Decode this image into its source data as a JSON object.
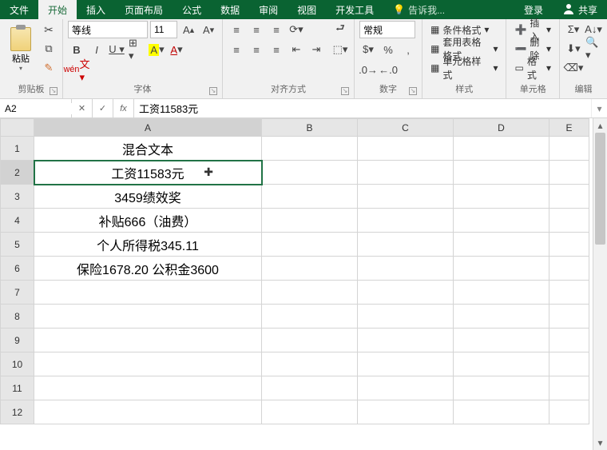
{
  "accent": "#217346",
  "tabs": {
    "file": "文件",
    "home": "开始",
    "insert": "插入",
    "layout": "页面布局",
    "formulas": "公式",
    "data": "数据",
    "review": "审阅",
    "view": "视图",
    "dev": "开发工具",
    "tellme": "告诉我...",
    "login": "登录",
    "share": "共享"
  },
  "ribbon": {
    "clipboard": {
      "paste": "粘贴",
      "label": "剪贴板"
    },
    "font": {
      "name": "等线",
      "size": "11",
      "label": "字体"
    },
    "align": {
      "label": "对齐方式"
    },
    "number": {
      "format": "常规",
      "label": "数字"
    },
    "styles": {
      "cond": "条件格式",
      "table": "套用表格格式",
      "cell": "单元格样式",
      "label": "样式"
    },
    "cells": {
      "insert": "插入",
      "delete": "删除",
      "format": "格式",
      "label": "单元格"
    },
    "editing": {
      "label": "编辑"
    }
  },
  "namebox": "A2",
  "formula": "工资11583元",
  "columns": [
    "A",
    "B",
    "C",
    "D",
    "E"
  ],
  "chart_data": {
    "type": "table",
    "title": "混合文本",
    "columns": [
      "A"
    ],
    "rows": [
      {
        "row": 1,
        "A": "混合文本"
      },
      {
        "row": 2,
        "A": "工资11583元"
      },
      {
        "row": 3,
        "A": "3459绩效奖"
      },
      {
        "row": 4,
        "A": "补贴666（油费）"
      },
      {
        "row": 5,
        "A": "个人所得税345.11"
      },
      {
        "row": 6,
        "A": "保险1678.20 公积金3600"
      }
    ]
  },
  "rows": [
    "1",
    "2",
    "3",
    "4",
    "5",
    "6",
    "7",
    "8",
    "9",
    "10",
    "11",
    "12"
  ],
  "cells": {
    "r1": "混合文本",
    "r2": "工资11583元",
    "r3": "3459绩效奖",
    "r4": "补贴666（油费）",
    "r5": "个人所得税345.11",
    "r6": "保险1678.20 公积金3600"
  },
  "selected": {
    "row": 2,
    "col": "A"
  }
}
